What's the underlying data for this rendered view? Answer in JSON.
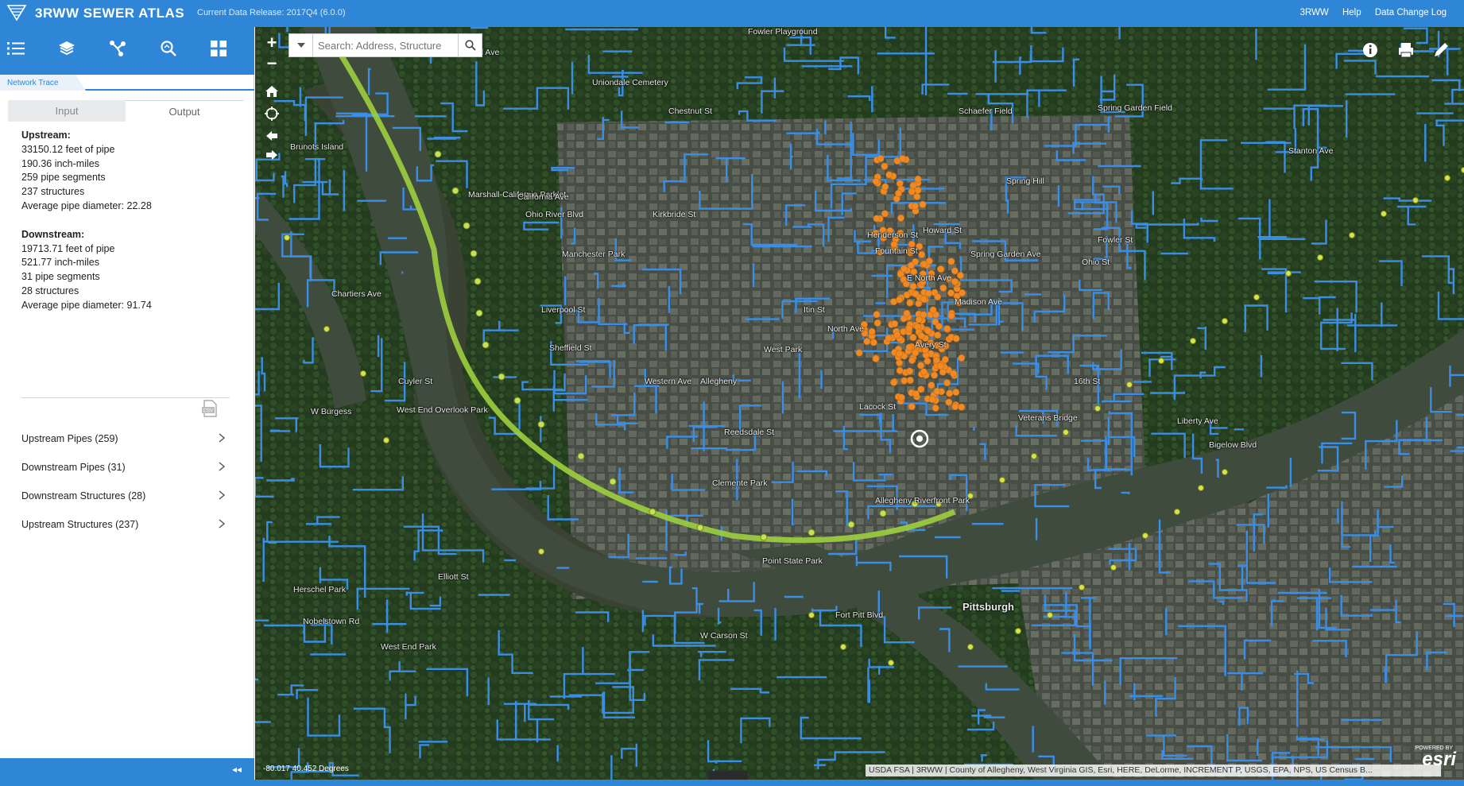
{
  "app": {
    "title": "3RWW SEWER ATLAS",
    "release": "Current Data Release: 2017Q4 (6.0.0)",
    "links": [
      "3RWW",
      "Help",
      "Data Change Log"
    ]
  },
  "toolbar": {
    "icons": [
      "list-icon",
      "layers-icon",
      "network-trace-icon",
      "search-map-icon",
      "grid-icon"
    ]
  },
  "panel": {
    "tab": "Network Trace",
    "input_tab": "Input",
    "output_tab": "Output",
    "upstream": {
      "heading": "Upstream:",
      "lines": [
        "33150.12 feet of pipe",
        "190.36 inch-miles",
        "259 pipe segments",
        "237 structures",
        "Average pipe diameter: 22.28"
      ]
    },
    "downstream": {
      "heading": "Downstream:",
      "lines": [
        "19713.71 feet of pipe",
        "521.77 inch-miles",
        "31 pipe segments",
        "28 structures",
        "Average pipe diameter: 91.74"
      ]
    },
    "results": [
      "Upstream Pipes (259)",
      "Downstream Pipes (31)",
      "Downstream Structures (28)",
      "Upstream Structures (237)"
    ]
  },
  "map": {
    "search_placeholder": "Search: Address, Structure",
    "attribution": "USDA FSA | 3RWW | County of Allegheny, West Virginia GIS, Esri, HERE, DeLorme, INCREMENT P, USGS, EPA, NPS, US Census B...",
    "coordinates": "-80.017 40.452 Degrees",
    "logo": "esri",
    "powered": "POWERED BY",
    "labels": [
      "West End Overlook Park",
      "Marshall-California Parklet",
      "Manchester Park",
      "Reedsdale St",
      "Clemente Park",
      "Allegheny Riverfront Park",
      "Point State Park",
      "Pittsburgh",
      "Fort Pitt Blvd",
      "W Carson St",
      "E North Ave",
      "Avery St",
      "West Park",
      "Allegheny",
      "Spring Hill",
      "Spring Garden Field",
      "Fowler Playground",
      "Uniondale Cemetery",
      "Chartiers Ave",
      "Brunots Island",
      "West End Park",
      "Herschel Park",
      "Nobelstown Rd",
      "Ohio River Blvd",
      "Lacock St",
      "Kirkbride St",
      "California Ave",
      "Liverpool St",
      "Sheffield St",
      "Western Ave",
      "Veterans Bridge",
      "16th St",
      "Liberty Ave",
      "Bigelow Blvd",
      "Stanton Ave",
      "Woodland Ave",
      "Henderson St",
      "Howard St",
      "Madison Ave",
      "Spring Garden Ave",
      "Ohio St",
      "Fountain St",
      "W Burgess",
      "Itin St",
      "Cuyler St",
      "Fowler St",
      "Schaefer Field",
      "Chestnut St",
      "North Ave",
      "Elliott St"
    ]
  }
}
